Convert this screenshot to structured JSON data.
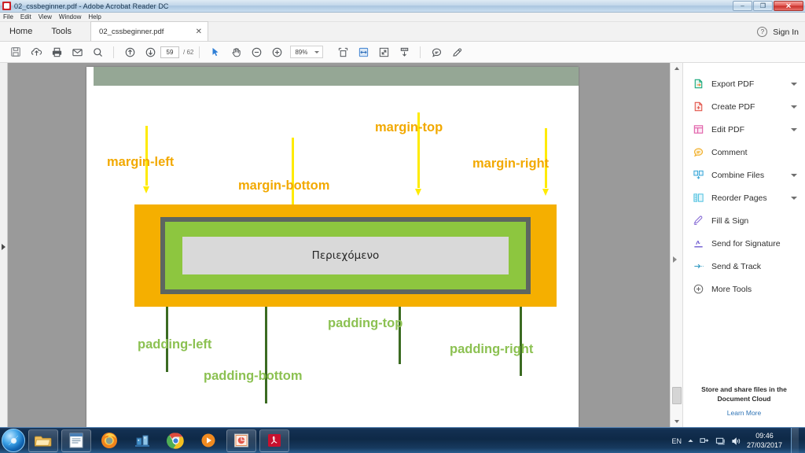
{
  "window": {
    "title": "02_cssbeginner.pdf - Adobe Acrobat Reader DC",
    "app_icon": "acrobat-icon",
    "minimize": "–",
    "maximize": "❐",
    "close": "✕"
  },
  "menubar": {
    "items": [
      {
        "label": "File"
      },
      {
        "label": "Edit"
      },
      {
        "label": "View"
      },
      {
        "label": "Window"
      },
      {
        "label": "Help"
      }
    ]
  },
  "tabbar": {
    "home": "Home",
    "tools": "Tools",
    "document_tab": "02_cssbeginner.pdf",
    "document_tab_close": "✕",
    "help_icon": "?",
    "sign_in": "Sign In"
  },
  "toolbar": {
    "icons": [
      {
        "name": "save-icon"
      },
      {
        "name": "upload-cloud-icon"
      },
      {
        "name": "print-icon"
      },
      {
        "name": "email-icon"
      },
      {
        "name": "search-icon"
      },
      {
        "name": "previous-page-icon"
      },
      {
        "name": "next-page-icon"
      },
      {
        "name": "select-cursor-icon"
      },
      {
        "name": "hand-tool-icon"
      },
      {
        "name": "zoom-out-icon"
      },
      {
        "name": "zoom-in-icon"
      },
      {
        "name": "fit-page-icon"
      },
      {
        "name": "fit-width-icon"
      },
      {
        "name": "fullscreen-icon"
      },
      {
        "name": "scroll-mode-icon"
      },
      {
        "name": "comment-icon"
      },
      {
        "name": "highlight-icon"
      }
    ],
    "page_current": "59",
    "page_total": "/ 62",
    "zoom_level": "89%"
  },
  "document": {
    "content_label": "Περιεχόμενο",
    "labels": [
      {
        "id": "margin-left",
        "text": "margin-left",
        "kind": "margin"
      },
      {
        "id": "margin-top",
        "text": "margin-top",
        "kind": "margin"
      },
      {
        "id": "margin-right",
        "text": "margin-right",
        "kind": "margin"
      },
      {
        "id": "margin-bottom",
        "text": "margin-bottom",
        "kind": "margin"
      },
      {
        "id": "padding-left",
        "text": "padding-left",
        "kind": "padding"
      },
      {
        "id": "padding-top",
        "text": "padding-top",
        "kind": "padding"
      },
      {
        "id": "padding-right",
        "text": "padding-right",
        "kind": "padding"
      },
      {
        "id": "padding-bottom",
        "text": "padding-bottom",
        "kind": "padding"
      }
    ],
    "colors": {
      "margin_box": "#f5af00",
      "border_box": "#5d6660",
      "padding_box": "#8dc63f",
      "content_box": "#d9d9d9",
      "margin_label": "#f2a900",
      "padding_label": "#8cc152",
      "margin_arrow": "#ffeb00",
      "padding_arrow": "#3b6b22",
      "slide_band": "#95a795"
    }
  },
  "sidebar": {
    "items": [
      {
        "label": "Export PDF",
        "icon": "export-pdf-icon",
        "chevron": true
      },
      {
        "label": "Create PDF",
        "icon": "create-pdf-icon",
        "chevron": true
      },
      {
        "label": "Edit PDF",
        "icon": "edit-pdf-icon",
        "chevron": true
      },
      {
        "label": "Comment",
        "icon": "comment-icon",
        "chevron": false
      },
      {
        "label": "Combine Files",
        "icon": "combine-files-icon",
        "chevron": true
      },
      {
        "label": "Reorder Pages",
        "icon": "reorder-pages-icon",
        "chevron": true
      },
      {
        "label": "Fill & Sign",
        "icon": "fill-and-sign-icon",
        "chevron": false
      },
      {
        "label": "Send for Signature",
        "icon": "send-for-signature-icon",
        "chevron": false
      },
      {
        "label": "Send & Track",
        "icon": "send-and-track-icon",
        "chevron": false
      },
      {
        "label": "More Tools",
        "icon": "more-tools-icon",
        "chevron": false
      }
    ],
    "promo_line1": "Store and share files in the",
    "promo_line2": "Document Cloud",
    "promo_link": "Learn More"
  },
  "taskbar": {
    "start": "start-orb",
    "buttons": [
      {
        "name": "windows-explorer-icon"
      },
      {
        "name": "word-document-icon"
      },
      {
        "name": "firefox-icon"
      },
      {
        "name": "blue-app-icon"
      },
      {
        "name": "chrome-icon"
      },
      {
        "name": "media-player-icon"
      },
      {
        "name": "powerpoint-icon"
      },
      {
        "name": "acrobat-reader-icon"
      }
    ],
    "tray": {
      "language": "EN",
      "icons": [
        "show-hidden-icons",
        "network-icon",
        "action-center-icon",
        "volume-icon"
      ],
      "time": "09:46",
      "date": "27/03/2017"
    }
  }
}
